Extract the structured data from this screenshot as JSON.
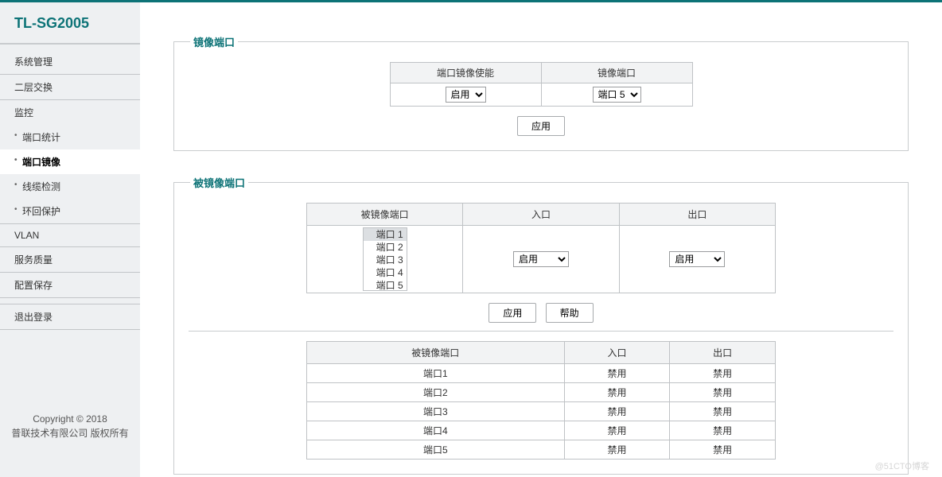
{
  "brand": "TL-SG2005",
  "nav": {
    "system": "系统管理",
    "l2": "二层交换",
    "monitor": "监控",
    "port_stats": "端口统计",
    "port_mirror": "端口镜像",
    "cable_test": "线缆检测",
    "loop_prot": "环回保护",
    "vlan": "VLAN",
    "qos": "服务质量",
    "save": "配置保存",
    "logout": "退出登录"
  },
  "footer": {
    "line1": "Copyright © 2018",
    "line2": "普联技术有限公司 版权所有"
  },
  "panel1": {
    "legend": "镜像端口",
    "col1": "端口镜像使能",
    "col2": "镜像端口",
    "enable_value": "启用",
    "port_value": "端口 5",
    "apply": "应用"
  },
  "panel2": {
    "legend": "被镜像端口",
    "col_mirrored": "被镜像端口",
    "col_ingress": "入口",
    "col_egress": "出口",
    "port_options": [
      "端口 1",
      "端口 2",
      "端口 3",
      "端口 4",
      "端口 5"
    ],
    "selected_port_idx": 0,
    "ingress_value": "启用",
    "egress_value": "启用",
    "apply": "应用",
    "help": "帮助",
    "status_rows": [
      {
        "port": "端口1",
        "ingress": "禁用",
        "egress": "禁用"
      },
      {
        "port": "端口2",
        "ingress": "禁用",
        "egress": "禁用"
      },
      {
        "port": "端口3",
        "ingress": "禁用",
        "egress": "禁用"
      },
      {
        "port": "端口4",
        "ingress": "禁用",
        "egress": "禁用"
      },
      {
        "port": "端口5",
        "ingress": "禁用",
        "egress": "禁用"
      }
    ]
  },
  "watermark": "@51CTO博客"
}
